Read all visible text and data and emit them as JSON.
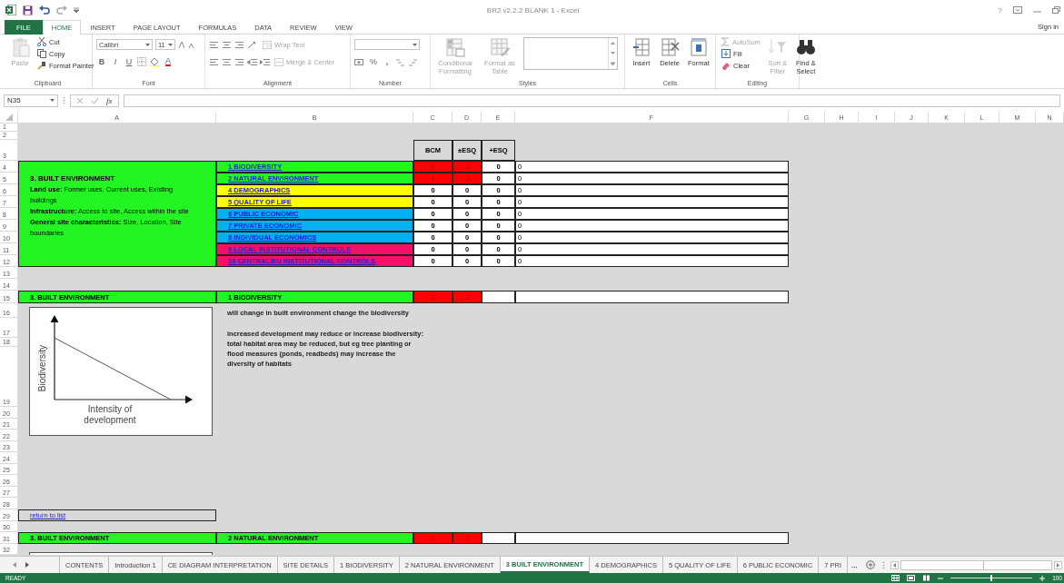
{
  "title_bar": {
    "title": "BR2 v2.2.2 BLANK 1 - Excel",
    "help": "?"
  },
  "ribbon_tabs": [
    {
      "label": "FILE",
      "kind": "file",
      "selected": false
    },
    {
      "label": "HOME",
      "kind": "tab",
      "selected": true
    },
    {
      "label": "INSERT",
      "kind": "tab",
      "selected": false
    },
    {
      "label": "PAGE LAYOUT",
      "kind": "tab",
      "selected": false
    },
    {
      "label": "FORMULAS",
      "kind": "tab",
      "selected": false
    },
    {
      "label": "DATA",
      "kind": "tab",
      "selected": false
    },
    {
      "label": "REVIEW",
      "kind": "tab",
      "selected": false
    },
    {
      "label": "VIEW",
      "kind": "tab",
      "selected": false
    }
  ],
  "account": {
    "sign_in": "Sign in"
  },
  "ribbon": {
    "groups": [
      {
        "kind": "clipboard",
        "name": "Clipboard",
        "items": [
          {
            "label": "Paste",
            "disabled": true
          },
          {
            "label": "Cut",
            "disabled": false
          },
          {
            "label": "Copy",
            "disabled": false
          },
          {
            "label": "Format Painter",
            "disabled": false
          }
        ]
      },
      {
        "kind": "font",
        "name": "Font",
        "font": "Calibri",
        "size": "11",
        "items": [
          {
            "label": "B"
          },
          {
            "label": "I"
          },
          {
            "label": "U"
          },
          {
            "label": "A"
          }
        ]
      },
      {
        "kind": "alignment",
        "name": "Alignment",
        "items": [
          {
            "label": "Wrap Text",
            "disabled": true
          },
          {
            "label": "Merge & Center",
            "disabled": true
          }
        ]
      },
      {
        "kind": "number",
        "name": "Number",
        "items": [
          {
            "label": "%"
          },
          {
            "label": ","
          }
        ]
      },
      {
        "kind": "styles",
        "name": "Styles",
        "items": [
          {
            "label": "Conditional Formatting",
            "disabled": true
          },
          {
            "label": "Format as Table",
            "disabled": true
          }
        ]
      },
      {
        "kind": "cells",
        "name": "Cells",
        "items": [
          {
            "label": "Insert"
          },
          {
            "label": "Delete"
          },
          {
            "label": "Format"
          }
        ]
      },
      {
        "kind": "editing",
        "name": "Editing",
        "items": [
          {
            "label": "AutoSum",
            "disabled": true
          },
          {
            "label": "Fill",
            "disabled": false
          },
          {
            "label": "Clear",
            "disabled": false
          },
          {
            "label": "Sort & Filter",
            "disabled": true
          },
          {
            "label": "Find & Select",
            "disabled": false
          }
        ]
      }
    ]
  },
  "formula_bar": {
    "name_box": "N35",
    "function_label": "fx"
  },
  "sheet": {
    "columns": [
      "A",
      "B",
      "C",
      "D",
      "E",
      "F",
      "G",
      "H",
      "I",
      "J",
      "K",
      "L",
      "M",
      "N"
    ],
    "rows": [
      "1",
      "2",
      "3",
      "4",
      "5",
      "6",
      "7",
      "8",
      "9",
      "10",
      "11",
      "12",
      "13",
      "14",
      "15",
      "16",
      "17",
      "18",
      "19",
      "20",
      "21",
      "22",
      "23",
      "24",
      "25",
      "26",
      "27",
      "28",
      "29",
      "30",
      "31",
      "32"
    ],
    "score_headers": [
      "BCM",
      "±ESQ",
      "+ESQ"
    ],
    "summary": {
      "title": "3. BUILT ENVIRONMENT",
      "lines": [
        "**Land use:** Former uses, Current uses, Existing buildings",
        "**Infrastructure:** Access to site, Access within the site",
        "**General site characteristics:** Size, Location, Site boundaries"
      ]
    },
    "categories": [
      {
        "label": "1 BIODIVERSITY",
        "color": "#22f522",
        "bcm": "1",
        "esq": "-2",
        "plus_esq": "0",
        "column_f": "0",
        "flagged": true
      },
      {
        "label": "2 NATURAL ENVIRONMENT",
        "color": "#22f522",
        "bcm": "1",
        "esq": "-2",
        "plus_esq": "0",
        "column_f": "0",
        "flagged": true
      },
      {
        "label": "4 DEMOGRAPHICS",
        "color": "#ffff00",
        "bcm": "0",
        "esq": "0",
        "plus_esq": "0",
        "column_f": "0",
        "flagged": false
      },
      {
        "label": "5 QUALITY OF LIFE",
        "color": "#ffff00",
        "bcm": "0",
        "esq": "0",
        "plus_esq": "0",
        "column_f": "0",
        "flagged": false
      },
      {
        "label": "6 PUBLIC ECONOMIC",
        "color": "#00b0f0",
        "bcm": "0",
        "esq": "0",
        "plus_esq": "0",
        "column_f": "0",
        "flagged": false
      },
      {
        "label": "7 PRIVATE ECONOMIC",
        "color": "#00b0f0",
        "bcm": "0",
        "esq": "0",
        "plus_esq": "0",
        "column_f": "0",
        "flagged": false
      },
      {
        "label": "8 INDIVIDUAL ECONOMICS",
        "color": "#00b0f0",
        "bcm": "0",
        "esq": "0",
        "plus_esq": "0",
        "column_f": "0",
        "flagged": false
      },
      {
        "label": "9 LOCAL INSTITUTIONAL CONTROLS",
        "color": "#f5106a",
        "bcm": "0",
        "esq": "0",
        "plus_esq": "0",
        "column_f": "0",
        "flagged": false
      },
      {
        "label": "10 CENTRAL/EU INSTITUTIONAL CONTROLS",
        "color": "#f5106a",
        "bcm": "0",
        "esq": "0",
        "plus_esq": "0",
        "column_f": "0",
        "flagged": false
      }
    ],
    "detail_rows": [
      {
        "section": "3. BUILT ENVIRONMENT",
        "category": "1 BIODIVERSITY",
        "bcm": "1",
        "esq": "-2",
        "flagged": true
      },
      {
        "section": "3. BUILT ENVIRONMENT",
        "category": "2 NATURAL ENVIRONMENT",
        "bcm": "1",
        "esq": "-2",
        "flagged": true
      }
    ],
    "figure": {
      "ylabel": "Biodiversity",
      "xlabel": "Intensity of development"
    },
    "notes": [
      "will change in built environment change the biodiversity",
      "increased development may reduce or increase biodiversity: total habitat area may be reduced, but eg tree planting or flood measures (ponds, readbeds) may increase the diversity of habitats"
    ],
    "link": "return to list"
  },
  "sheet_tabs": {
    "tabs": [
      {
        "label": "CONTENTS",
        "selected": false
      },
      {
        "label": "Introduction 1",
        "selected": false
      },
      {
        "label": "CE DIAGRAM INTERPRETATION",
        "selected": false
      },
      {
        "label": "SITE DETAILS",
        "selected": false
      },
      {
        "label": "1 BIODIVERSITY",
        "selected": false
      },
      {
        "label": "2 NATURAL ENVIRONMENT",
        "selected": false
      },
      {
        "label": "3 BUILT ENVIRONMENT",
        "selected": true
      },
      {
        "label": "4 DEMOGRAPHICS",
        "selected": false
      },
      {
        "label": "5 QUALITY OF LIFE",
        "selected": false
      },
      {
        "label": "6 PUBLIC ECONOMIC",
        "selected": false
      },
      {
        "label": "7 PRI",
        "selected": false
      }
    ],
    "overflow": "..."
  },
  "status_bar": {
    "status": "READY",
    "level": 0.5,
    "zoom": "100"
  }
}
